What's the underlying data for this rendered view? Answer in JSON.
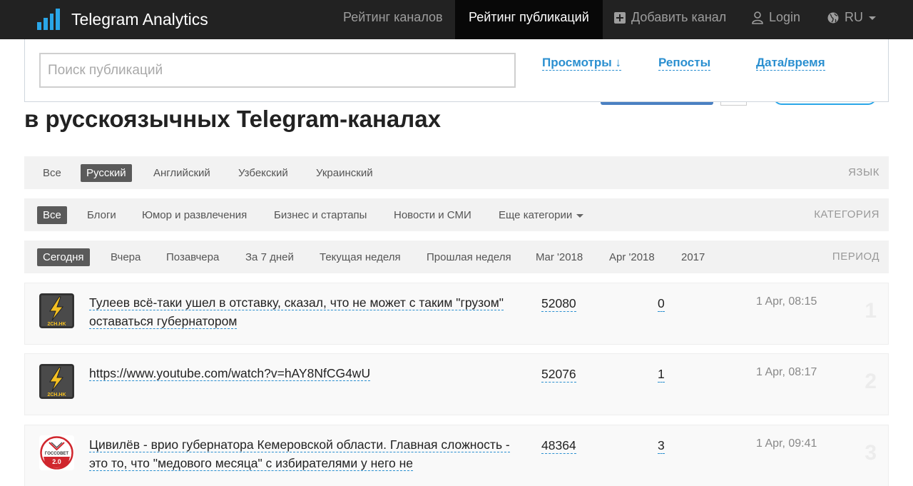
{
  "brand": {
    "title": "Telegram Analytics"
  },
  "nav": {
    "channels_rating": "Рейтинг каналов",
    "posts_rating": "Рейтинг публикаций",
    "add_channel": "Добавить канал",
    "login": "Login",
    "language": "RU"
  },
  "search": {
    "placeholder": "Поиск публикаций",
    "value": ""
  },
  "sort": {
    "views": "Просмотры ↓",
    "reposts": "Репосты",
    "datetime": "Дата/время"
  },
  "page_title": "в русскоязычных Telegram-каналах",
  "filters": {
    "language": {
      "label": "ЯЗЫК",
      "options": [
        "Все",
        "Русский",
        "Английский",
        "Узбекский",
        "Украинский"
      ],
      "selected": "Русский"
    },
    "category": {
      "label": "КАТЕГОРИЯ",
      "options": [
        "Все",
        "Блоги",
        "Юмор и развлечения",
        "Бизнес и стартапы",
        "Новости и СМИ",
        "Еще категории"
      ],
      "selected": "Все"
    },
    "period": {
      "label": "ПЕРИОД",
      "options": [
        "Сегодня",
        "Вчера",
        "Позавчера",
        "За 7 дней",
        "Текущая неделя",
        "Прошлая неделя",
        "Mar '2018",
        "Apr '2018",
        "2017"
      ],
      "selected": "Сегодня"
    }
  },
  "posts": [
    {
      "title": "Тулеев всё-таки ушел в отставку, сказал, что не может с таким \"грузом\" оставаться губернатором",
      "views": "52080",
      "reposts": "0",
      "time": "1 Apr, 08:15",
      "rank": "1",
      "avatar_text": "2CH.HK",
      "avatar_icon": "lightning-icon"
    },
    {
      "title": "https://www.youtube.com/watch?v=hAY8NfCG4wU",
      "views": "52076",
      "reposts": "1",
      "time": "1 Apr, 08:17",
      "rank": "2",
      "avatar_text": "2CH.HK",
      "avatar_icon": "lightning-icon"
    },
    {
      "title": "Цивилёв - врио губернатора Кемеровской области. Главная сложность - это то, что \"медового месяца\" с избирателями у него не",
      "views": "48364",
      "reposts": "3",
      "time": "1 Apr, 09:41",
      "rank": "3",
      "avatar_text": "ГОССОВЕТ",
      "avatar_subtext": "2.0",
      "avatar_icon": "gossovet-logo"
    }
  ],
  "colors": {
    "accent": "#2a8fd0",
    "brand": "#2aa6e8",
    "navbar": "#222222"
  }
}
